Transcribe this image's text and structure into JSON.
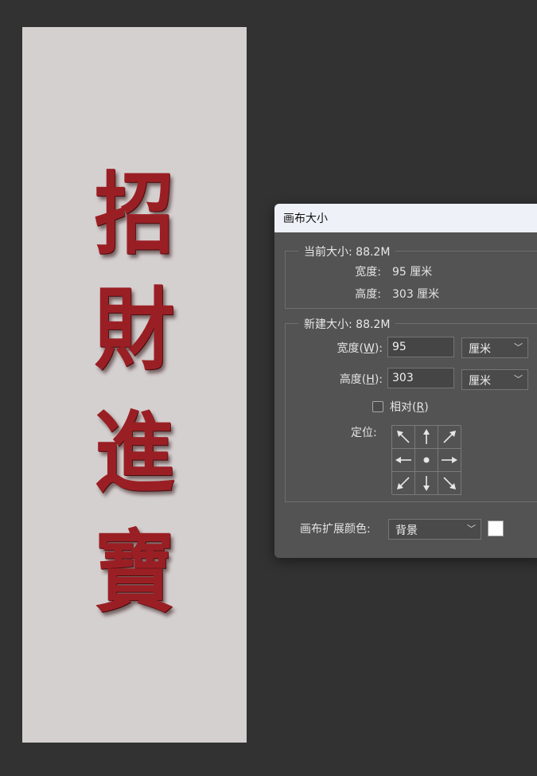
{
  "document": {
    "characters": [
      "招",
      "財",
      "進",
      "寶"
    ],
    "canvas_color": "#d5d0d0",
    "text_color": "#9a1f24"
  },
  "dialog": {
    "title": "画布大小",
    "current": {
      "legend": "当前大小: 88.2M",
      "width_label": "宽度:",
      "width_value": "95 厘米",
      "height_label": "高度:",
      "height_value": "303 厘米"
    },
    "new": {
      "legend": "新建大小: 88.2M",
      "width_label_prefix": "宽度(",
      "width_label_key": "W",
      "width_label_suffix": "):",
      "width_value": "95",
      "width_unit": "厘米",
      "height_label_prefix": "高度(",
      "height_label_key": "H",
      "height_label_suffix": "):",
      "height_value": "303",
      "height_unit": "厘米",
      "relative_label_prefix": "相对(",
      "relative_label_key": "R",
      "relative_label_suffix": ")",
      "relative_checked": false,
      "anchor_label": "定位:"
    },
    "extension": {
      "label": "画布扩展颜色:",
      "value": "背景",
      "swatch_color": "#ffffff"
    }
  }
}
